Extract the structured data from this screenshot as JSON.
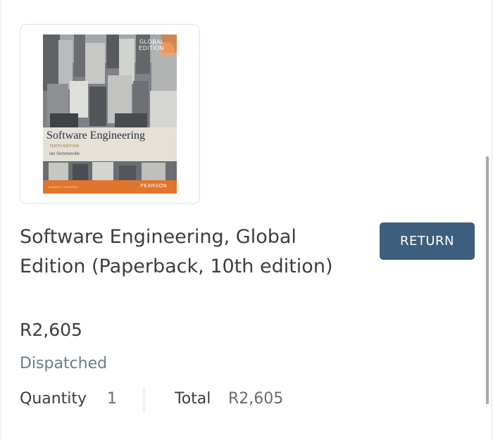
{
  "product": {
    "title": "Software Engineering, Global Edition (Paperback, 10th edition)",
    "price": "R2,605",
    "status": "Dispatched",
    "quantity_label": "Quantity",
    "quantity_value": "1",
    "total_label": "Total",
    "total_value": "R2,605"
  },
  "actions": {
    "return_label": "RETURN"
  },
  "cover": {
    "title": "Software Engineering",
    "edition": "TENTH EDITION",
    "author": "Ian Sommerville",
    "badge": "GLOBAL EDITION",
    "publisher": "PEARSON",
    "footer_small": "ALWAYS LEARNING"
  },
  "colors": {
    "button": "#3d5e7d",
    "status_text": "#6d7a8a",
    "cover_orange": "#e0752c"
  }
}
